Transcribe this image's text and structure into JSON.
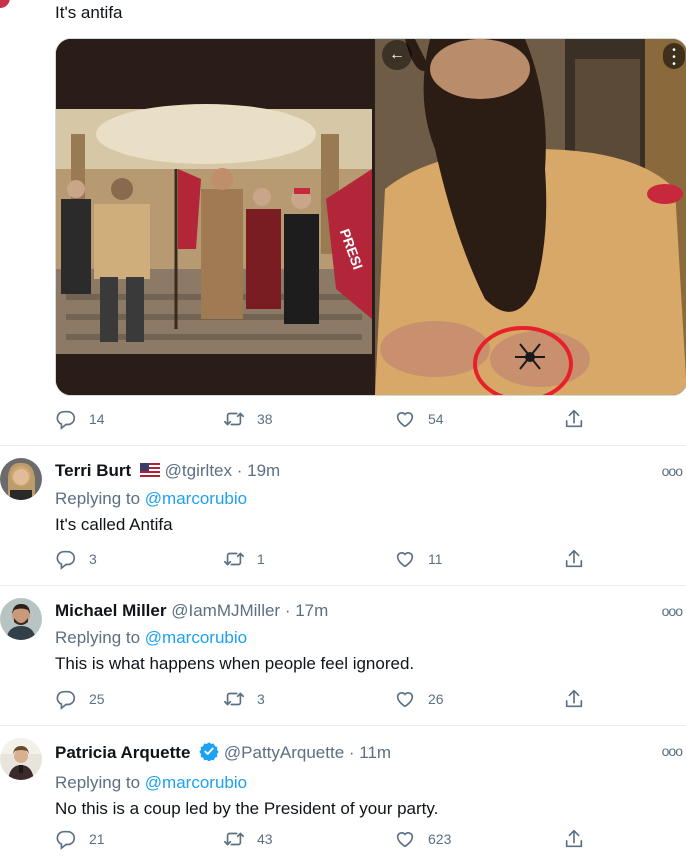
{
  "top_tweet": {
    "text": "It's antifa",
    "actions": {
      "replies": "14",
      "retweets": "38",
      "likes": "54"
    }
  },
  "replies": [
    {
      "name": "Terri Burt",
      "handle": "@tgirltex",
      "time": "19m",
      "replying_to_label": "Replying to",
      "replying_to": "@marcorubio",
      "text": "It's called Antifa",
      "actions": {
        "replies": "3",
        "retweets": "1",
        "likes": "11"
      }
    },
    {
      "name": "Michael Miller",
      "handle": "@IamMJMiller",
      "time": "17m",
      "replying_to_label": "Replying to",
      "replying_to": "@marcorubio",
      "text": "This is what happens when people feel ignored.",
      "actions": {
        "replies": "25",
        "retweets": "3",
        "likes": "26"
      }
    },
    {
      "name": "Patricia Arquette",
      "handle": "@PattyArquette",
      "time": "11m",
      "replying_to_label": "Replying to",
      "replying_to": "@marcorubio",
      "text": "No this is a coup led by the President of your party.",
      "actions": {
        "replies": "21",
        "retweets": "43",
        "likes": "623"
      }
    }
  ],
  "colors": {
    "link": "#1da1f2",
    "muted": "#5b7083",
    "text": "#0f1419",
    "verified": "#1da1f2"
  },
  "icons": [
    "reply-icon",
    "retweet-icon",
    "like-icon",
    "share-icon",
    "more-icon",
    "verified-icon",
    "us-flag-icon",
    "back-arrow-icon"
  ]
}
